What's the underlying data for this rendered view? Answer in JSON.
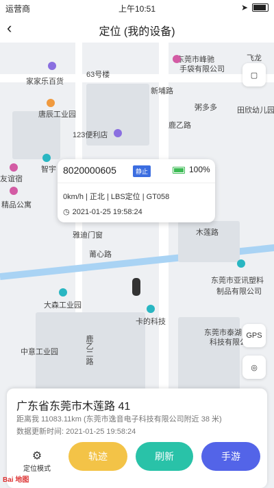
{
  "status": {
    "carrier": "运营商",
    "time": "上午10:51"
  },
  "nav": {
    "title": "定位 (我的设备)"
  },
  "map_labels": {
    "l1": "飞龙",
    "l2": "东莞市峰驰",
    "l3": "手袋有限公司",
    "l4": "63号楼",
    "l5": "家家乐百货",
    "l6": "新埔路",
    "l7": "粥多多",
    "l8": "田欣幼儿园",
    "l9": "唐辰工业园",
    "l10": "鹿乙路",
    "l11": "123便利店",
    "l12": "智宇",
    "l13": "友谊宿",
    "l14": "精品公寓",
    "l15": "雅迪门窗",
    "l16": "木莲路",
    "l17": "莆心路",
    "l18": "东莞市亚讯塑料",
    "l19": "制品有限公司",
    "l20": "大森工业园",
    "l21": "卡的科技",
    "l22": "东莞市泰湖",
    "l23": "科技有限公司",
    "l24": "中意工业园",
    "l25": "鹿乙二路"
  },
  "popup": {
    "device_id": "8020000605",
    "state": "静止",
    "battery": "100%",
    "info": "0km/h | 正北 | LBS定位 | GT058",
    "time": "2021-01-25 19:58:24"
  },
  "side": {
    "gps": "GPS"
  },
  "card": {
    "address": "广东省东莞市木莲路 41",
    "distance": "距离我 11083.11km (东莞市逸音电子科技有限公司附近 38 米)",
    "updated": "数据更新时间: 2021-01-25 19:58:24",
    "mode_label": "定位模式",
    "track_label": "轨迹",
    "refresh_label": "刷新",
    "third_label": "手游"
  },
  "watermark": "Bai 地图"
}
